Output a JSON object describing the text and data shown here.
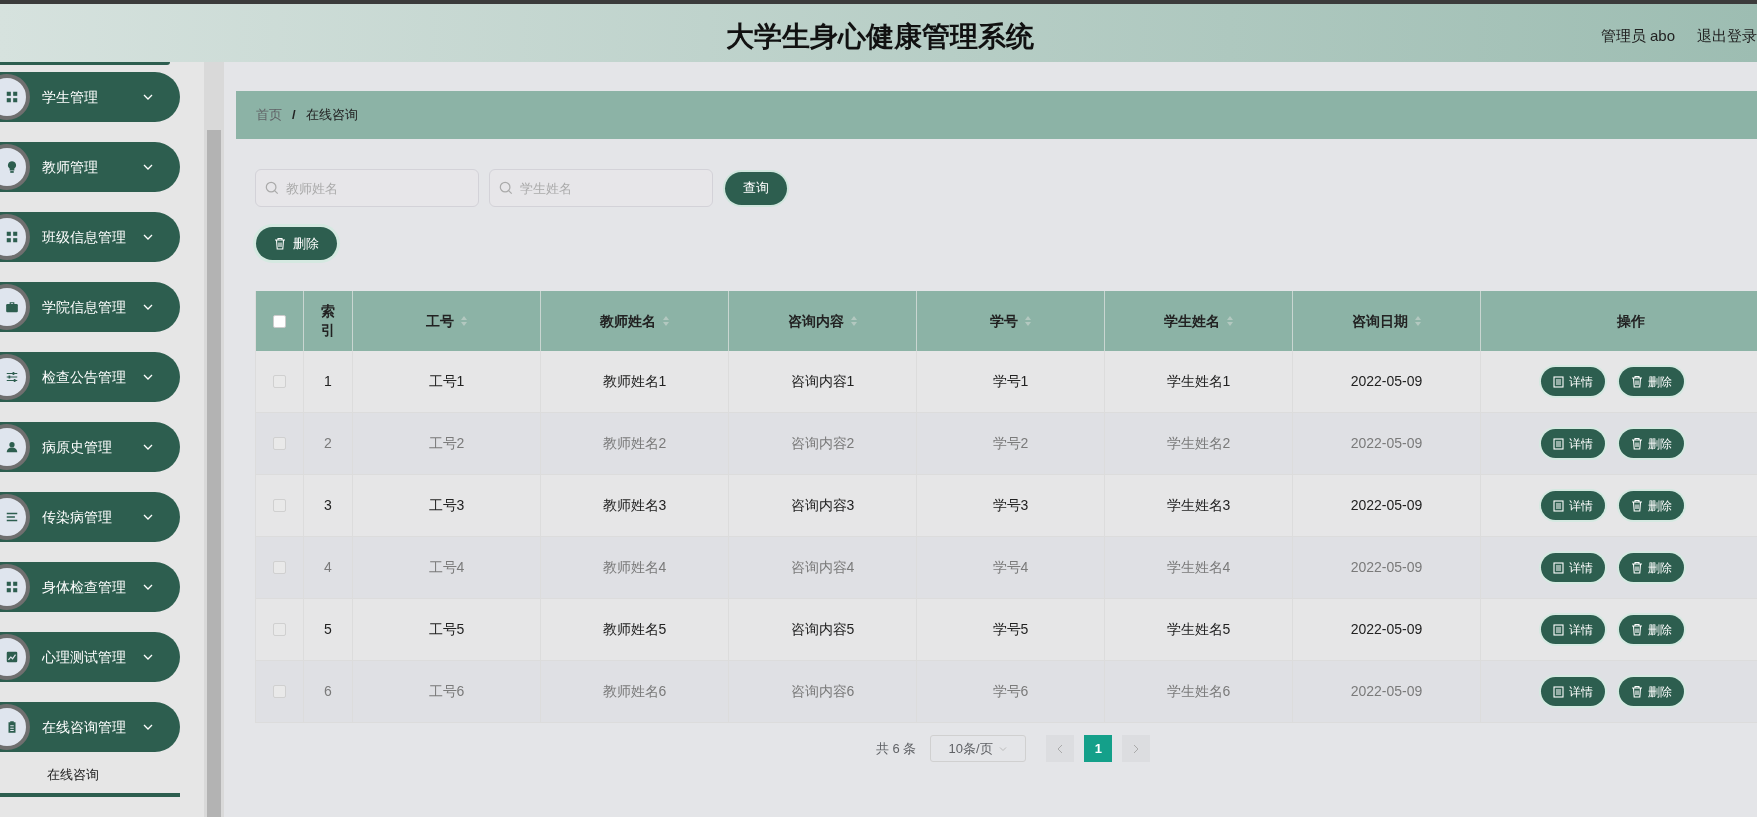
{
  "header": {
    "title": "大学生身心健康管理系统",
    "user": "管理员 abo",
    "logout": "退出登录"
  },
  "sidebar": {
    "items": [
      {
        "label": "学生管理",
        "kind": "grid"
      },
      {
        "label": "教师管理",
        "kind": "bulb"
      },
      {
        "label": "班级信息管理",
        "kind": "grid"
      },
      {
        "label": "学院信息管理",
        "kind": "briefcase"
      },
      {
        "label": "检查公告管理",
        "kind": "sliders"
      },
      {
        "label": "病原史管理",
        "kind": "user"
      },
      {
        "label": "传染病管理",
        "kind": "list"
      },
      {
        "label": "身体检查管理",
        "kind": "grid"
      },
      {
        "label": "心理测试管理",
        "kind": "chart"
      },
      {
        "label": "在线咨询管理",
        "kind": "clipboard",
        "children": [
          {
            "label": "在线咨询",
            "selected": true
          }
        ]
      }
    ]
  },
  "breadcrumb": {
    "items": [
      "首页",
      "在线咨询"
    ],
    "separator": "/"
  },
  "search": {
    "fields": [
      {
        "placeholder": "教师姓名"
      },
      {
        "placeholder": "学生姓名"
      }
    ],
    "button": "查询"
  },
  "toolbar": {
    "delete": "删除"
  },
  "table": {
    "header_checked": false,
    "columns": [
      {
        "label": "索引",
        "sortable": false
      },
      {
        "label": "工号",
        "sortable": true
      },
      {
        "label": "教师姓名",
        "sortable": true
      },
      {
        "label": "咨询内容",
        "sortable": true
      },
      {
        "label": "学号",
        "sortable": true
      },
      {
        "label": "学生姓名",
        "sortable": true
      },
      {
        "label": "咨询日期",
        "sortable": true
      },
      {
        "label": "操作",
        "sortable": false
      }
    ],
    "rows": [
      {
        "checked": false,
        "cells": [
          "1",
          "工号1",
          "教师姓名1",
          "咨询内容1",
          "学号1",
          "学生姓名1",
          "2022-05-09"
        ],
        "actions": [
          "详情",
          "删除"
        ]
      },
      {
        "checked": false,
        "cells": [
          "2",
          "工号2",
          "教师姓名2",
          "咨询内容2",
          "学号2",
          "学生姓名2",
          "2022-05-09"
        ],
        "actions": [
          "详情",
          "删除"
        ]
      },
      {
        "checked": false,
        "cells": [
          "3",
          "工号3",
          "教师姓名3",
          "咨询内容3",
          "学号3",
          "学生姓名3",
          "2022-05-09"
        ],
        "actions": [
          "详情",
          "删除"
        ]
      },
      {
        "checked": false,
        "cells": [
          "4",
          "工号4",
          "教师姓名4",
          "咨询内容4",
          "学号4",
          "学生姓名4",
          "2022-05-09"
        ],
        "actions": [
          "详情",
          "删除"
        ]
      },
      {
        "checked": false,
        "cells": [
          "5",
          "工号5",
          "教师姓名5",
          "咨询内容5",
          "学号5",
          "学生姓名5",
          "2022-05-09"
        ],
        "actions": [
          "详情",
          "删除"
        ]
      },
      {
        "checked": false,
        "cells": [
          "6",
          "工号6",
          "教师姓名6",
          "咨询内容6",
          "学号6",
          "学生姓名6",
          "2022-05-09"
        ],
        "actions": [
          "详情",
          "删除"
        ]
      }
    ]
  },
  "pagination": {
    "total": "共 6 条",
    "page_size": "10条/页",
    "pages": [
      {
        "label": "1",
        "selected": true
      }
    ]
  }
}
